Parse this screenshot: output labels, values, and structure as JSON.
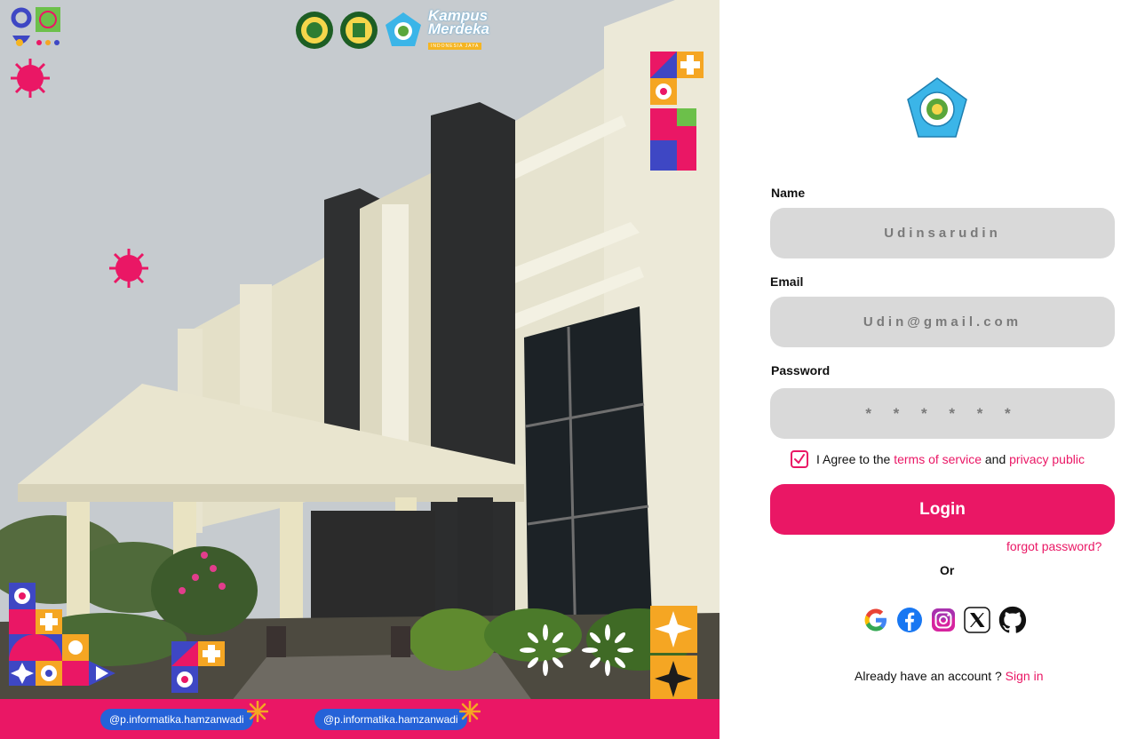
{
  "hero": {
    "social_tags": [
      "@p.informatika.hamzanwadi",
      "@p.informatika.hamzanwadi"
    ],
    "kampus_logo_text": [
      "Kampus",
      "Merdeka"
    ],
    "kampus_logo_sub": "INDONESIA JAYA",
    "colors": {
      "pink": "#ea1765",
      "orange": "#f5a623",
      "blue": "#3e47c4",
      "yellow": "#f5b522"
    }
  },
  "form": {
    "name": {
      "label": "Name",
      "value": "Udinsarudin"
    },
    "email": {
      "label": "Email",
      "value": "Udin@gmail.com"
    },
    "password": {
      "label": "Password",
      "value": "* * * * * *"
    },
    "agree": {
      "prefix": "I Agree to the",
      "terms": "terms of service",
      "and": "and",
      "privacy": "privacy public",
      "checked": true
    },
    "login_label": "Login",
    "forgot_label": "forgot password?",
    "or_label": "Or",
    "social_icons": [
      "google-icon",
      "facebook-icon",
      "instagram-icon",
      "x-icon",
      "github-icon"
    ],
    "signup_prefix": "Already have an account ?",
    "signup_link": "Sign in"
  },
  "colors": {
    "accent": "#ea1765",
    "field_bg": "#d9d9d9",
    "logo_blue": "#3bb5e8"
  }
}
